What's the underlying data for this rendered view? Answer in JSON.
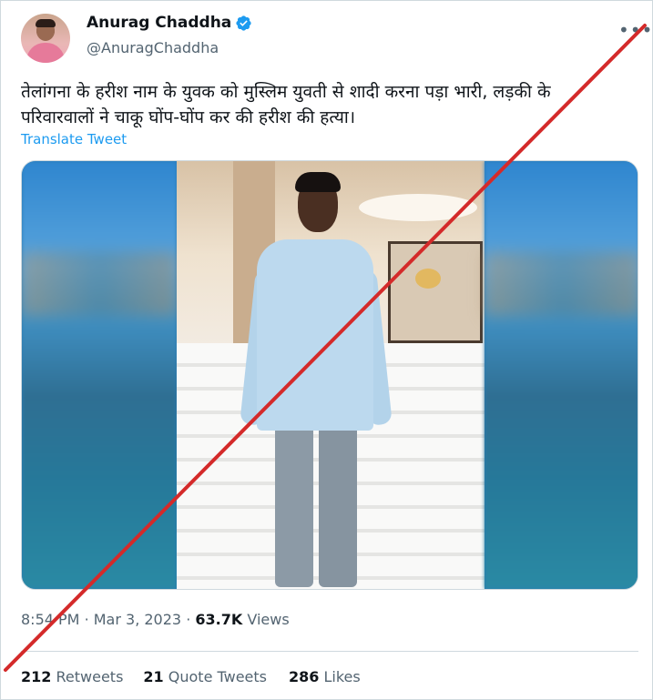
{
  "author": {
    "name": "Anurag Chaddha",
    "handle": "@AnuragChaddha",
    "verified": true
  },
  "menu": {
    "more_label": "•••"
  },
  "tweet": {
    "text_line1": "तेलांगना के हरीश नाम के युवक को मुस्लिम युवती से शादी करना पड़ा भारी, लड़की के",
    "text_line2": "परिवारवालों ने चाकू घोंप-घोंप कर की हरीश की हत्या।",
    "translate_label": "Translate Tweet"
  },
  "meta": {
    "time": "8:54 PM",
    "separator": "·",
    "date": "Mar 3, 2023",
    "views_count": "63.7K",
    "views_label": "Views"
  },
  "stats": {
    "retweets_count": "212",
    "retweets_label": "Retweets",
    "quotes_count": "21",
    "quotes_label": "Quote Tweets",
    "likes_count": "286",
    "likes_label": "Likes"
  },
  "colors": {
    "accent": "#1d9bf0",
    "cross_line": "#d42a2a",
    "text_secondary": "#536471"
  },
  "icons": [
    "verified-badge-icon",
    "more-options-icon"
  ]
}
